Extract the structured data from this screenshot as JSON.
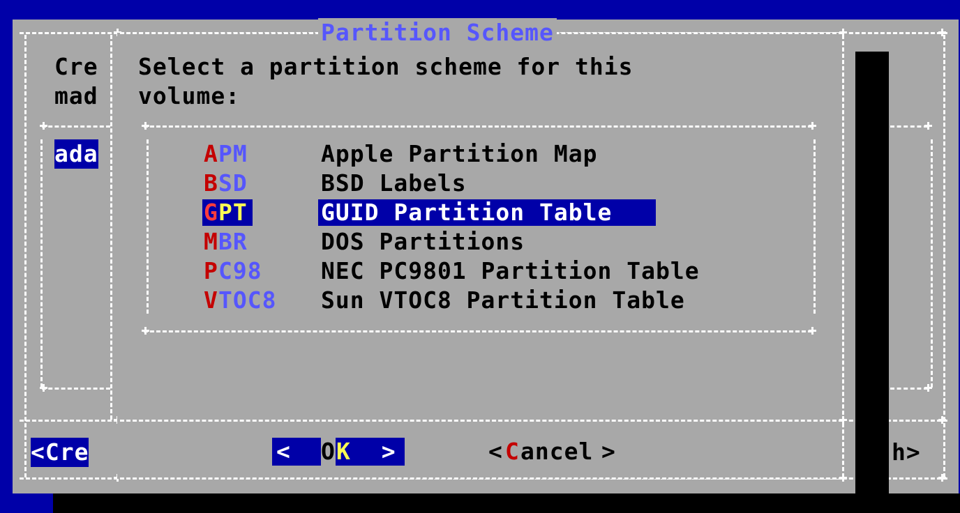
{
  "dialog": {
    "title": "Partition Scheme",
    "prompt_line1": "Select a partition scheme for this",
    "prompt_line2": "volume:"
  },
  "schemes": [
    {
      "hot": "A",
      "rest": "PM",
      "label": "Apple Partition Map",
      "selected": false
    },
    {
      "hot": "B",
      "rest": "SD",
      "label": "BSD Labels",
      "selected": false
    },
    {
      "hot": "G",
      "rest": "PT",
      "label": "GUID Partition Table",
      "selected": true
    },
    {
      "hot": "M",
      "rest": "BR",
      "label": "DOS Partitions",
      "selected": false
    },
    {
      "hot": "P",
      "rest": "C98",
      "label": "NEC PC9801 Partition Table",
      "selected": false
    },
    {
      "hot": "V",
      "rest": "TOC8",
      "label": "Sun VTOC8 Partition Table",
      "selected": false
    }
  ],
  "buttons": {
    "ok": {
      "left": "<  ",
      "pre": "O",
      "hot": "K",
      "right": "  >"
    },
    "cancel": {
      "open": "<",
      "hot": "C",
      "rest": "ancel",
      "close": ">"
    }
  },
  "background_dialog": {
    "text_line1": "Cre",
    "text_line2": "mad",
    "list_item": "ada",
    "button_left": "<Cre",
    "button_right_fragment": "h>"
  },
  "colors": {
    "screen": "#0000a8",
    "dialog": "#a8a8a8",
    "hotkey": "#c40000",
    "dim_text": "#5656fc",
    "selected_bg": "#0000a8",
    "selected_fg": "#ffffff",
    "focus_fg": "#fcfc54"
  }
}
